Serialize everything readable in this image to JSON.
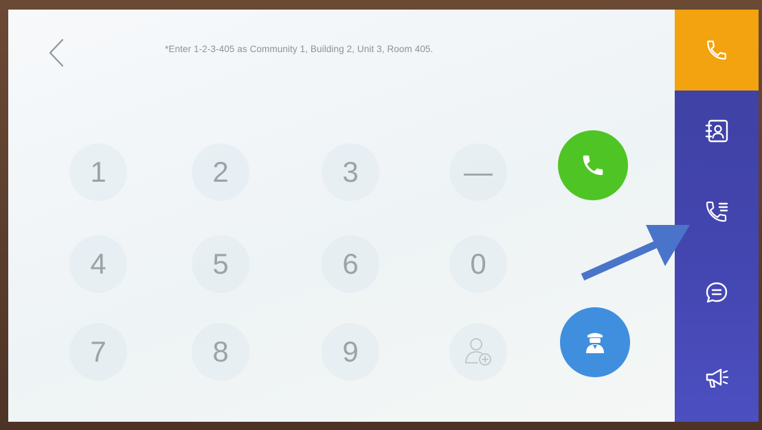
{
  "header": {
    "hint": "*Enter 1-2-3-405 as Community 1, Building 2, Unit 3, Room 405."
  },
  "keypad": {
    "keys": [
      "1",
      "2",
      "3",
      "—",
      "4",
      "5",
      "6",
      "0",
      "7",
      "8",
      "9"
    ]
  },
  "icons": {
    "back": "chevron-left-icon",
    "call": "phone-icon",
    "guard": "security-guard-icon",
    "add_contact": "add-contact-icon",
    "sidebar": [
      "phone-icon",
      "contacts-icon",
      "call-records-icon",
      "message-icon",
      "notice-megaphone-icon"
    ]
  },
  "colors": {
    "call_button": "#4ec524",
    "guard_button": "#3f8fde",
    "sidebar_active": "#f3a310",
    "sidebar_bg": "#4043a8",
    "annotation_arrow": "#4a74c9"
  }
}
